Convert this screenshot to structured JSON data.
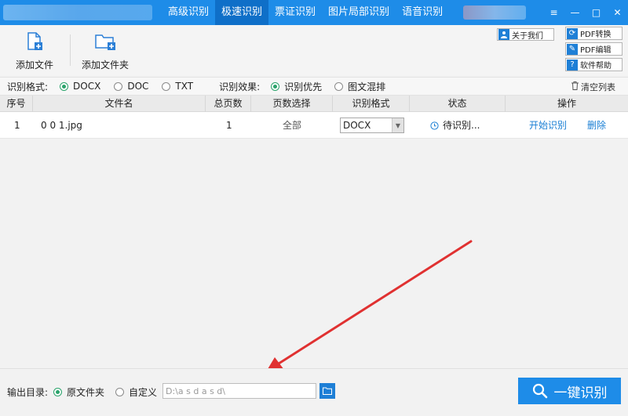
{
  "tabs": [
    {
      "label": "高级识别",
      "active": false
    },
    {
      "label": "极速识别",
      "active": true
    },
    {
      "label": "票证识别",
      "active": false
    },
    {
      "label": "图片局部识别",
      "active": false
    },
    {
      "label": "语音识别",
      "active": false
    }
  ],
  "window_controls": {
    "menu": "≡",
    "minimize": "—",
    "maximize": "□",
    "close": "✕"
  },
  "toolbar": {
    "add_file": "添加文件",
    "add_folder": "添加文件夹"
  },
  "side_buttons": {
    "about": "关于我们",
    "pdf_convert": "PDF转换",
    "pdf_edit": "PDF编辑",
    "help": "软件帮助"
  },
  "options": {
    "format_label": "识别格式:",
    "formats": [
      "DOCX",
      "DOC",
      "TXT"
    ],
    "format_selected": "DOCX",
    "effect_label": "识别效果:",
    "effects": [
      "识别优先",
      "图文混排"
    ],
    "effect_selected": "识别优先",
    "clear_list": "清空列表"
  },
  "table": {
    "headers": [
      "序号",
      "文件名",
      "总页数",
      "页数选择",
      "识别格式",
      "状态",
      "操作"
    ],
    "rows": [
      {
        "index": "1",
        "filename": "0 0 1.jpg",
        "pages": "1",
        "page_select": "全部",
        "format": "DOCX",
        "status": "待识别...",
        "action_start": "开始识别",
        "action_delete": "删除"
      }
    ]
  },
  "output": {
    "label": "输出目录:",
    "options": [
      "原文件夹",
      "自定义"
    ],
    "selected": "原文件夹",
    "path": "D:\\a s d a s d\\"
  },
  "primary_button": "一键识别",
  "colors": {
    "brand_blue": "#1e8ce8",
    "active_tab": "#0f6fc8",
    "radio_green": "#2aa36b",
    "link_blue": "#1a7fd4",
    "arrow_red": "#e03131"
  }
}
